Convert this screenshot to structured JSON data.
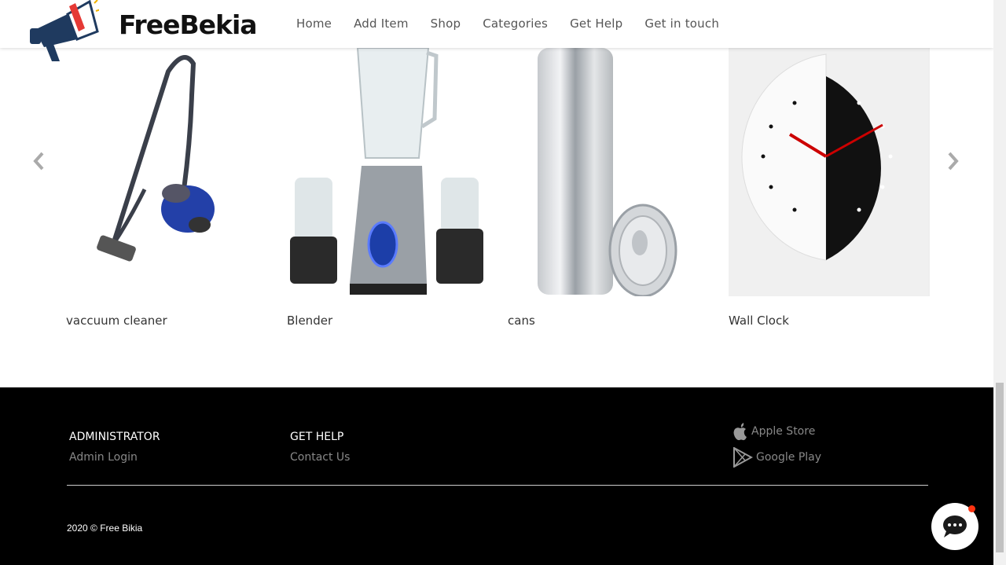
{
  "brand": {
    "name": "FreeBekia",
    "accent": "#e53935",
    "icon_color": "#1f3a5f"
  },
  "nav": {
    "items": [
      "Home",
      "Add Item",
      "Shop",
      "Categories",
      "Get Help",
      "Get in touch"
    ]
  },
  "carousel": {
    "prev_icon": "chevron-left-icon",
    "next_icon": "chevron-right-icon",
    "products": [
      {
        "name": "vaccuum cleaner"
      },
      {
        "name": "Blender"
      },
      {
        "name": "cans"
      },
      {
        "name": "Wall Clock"
      }
    ]
  },
  "footer": {
    "admin": {
      "title": "ADMINISTRATOR",
      "link": "Admin Login"
    },
    "help": {
      "title": "GET HELP",
      "link": "Contact Us"
    },
    "stores": {
      "apple": "Apple Store",
      "google": "Google Play"
    },
    "copyright": "2020 © Free Bikia"
  },
  "chat": {
    "icon": "chat-bubble-icon",
    "badge_color": "#ff3311"
  }
}
